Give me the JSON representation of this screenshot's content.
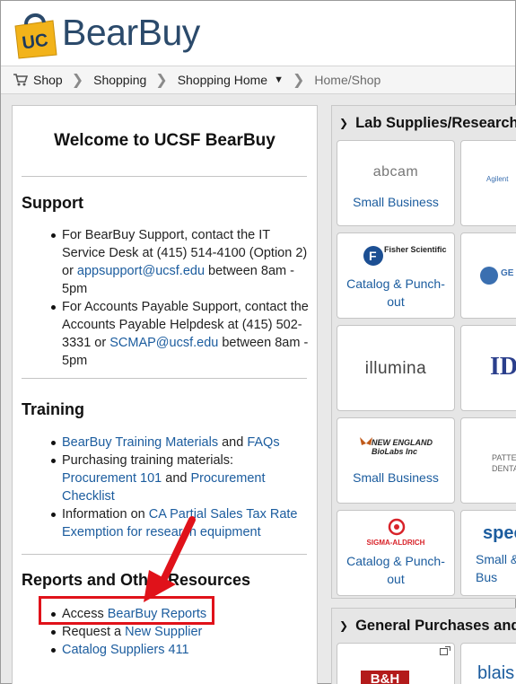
{
  "brand": {
    "name": "BearBuy",
    "badge": "UC"
  },
  "breadcrumb": {
    "items": [
      {
        "label": "Shop"
      },
      {
        "label": "Shopping"
      },
      {
        "label": "Shopping Home"
      },
      {
        "label": "Home/Shop"
      }
    ]
  },
  "left": {
    "welcome": "Welcome to UCSF BearBuy",
    "support": {
      "title": "Support",
      "item1_pre": "For BearBuy Support, contact the IT Service Desk at (415) 514-4100 (Option 2) or ",
      "item1_link": "appsupport@ucsf.edu",
      "item1_post": " between 8am - 5pm",
      "item2_pre": "For Accounts Payable Support, contact the Accounts Payable Helpdesk at (415) 502-3331 or ",
      "item2_link": "SCMAP@ucsf.edu",
      "item2_post": " between 8am - 5pm"
    },
    "training": {
      "title": "Training",
      "item1_link": "BearBuy Training Materials",
      "item1_mid": " and ",
      "item1_link2": "FAQs",
      "item2_pre": "Purchasing training materials: ",
      "item2_link": "Procurement 101",
      "item2_mid": " and ",
      "item2_link2": "Procurement Checklist",
      "item3_pre": "Information on ",
      "item3_link": "CA Partial Sales Tax Rate Exemption for research equipment"
    },
    "reports": {
      "title": "Reports and Other Resources",
      "item1_pre": "Access ",
      "item1_link": "BearBuy Reports",
      "item2_pre": "Request a ",
      "item2_link": "New Supplier",
      "item3_link": "Catalog Suppliers 411"
    }
  },
  "right": {
    "section1_title": "Lab Supplies/Research",
    "section2_title": "General Purchases and",
    "tiles": [
      {
        "logo": "abcam",
        "label": "Small Business"
      },
      {
        "logo": "Fisher Scientific",
        "label": "Catalog & Punch-out"
      },
      {
        "logo": "illumina",
        "label": ""
      },
      {
        "logo": "NEW ENGLAND BioLabs Inc",
        "label": "Small Business"
      },
      {
        "logo": "SIGMA-ALDRICH",
        "label": "Catalog & Punch-out"
      }
    ],
    "side_tiles": [
      {
        "logo": "Agilent"
      },
      {
        "logo": "GE"
      },
      {
        "logo": "ID"
      },
      {
        "logo": "PATTERSON DENTAL"
      },
      {
        "logo": "spec",
        "label": "Small & Bus"
      }
    ],
    "bottom_tiles": [
      {
        "logo": "B&H"
      },
      {
        "logo": "blais"
      }
    ]
  },
  "colors": {
    "link": "#1b5c9e",
    "highlight": "#e0121a",
    "brand": "#2b4a6b",
    "gold": "#f2b31a"
  }
}
